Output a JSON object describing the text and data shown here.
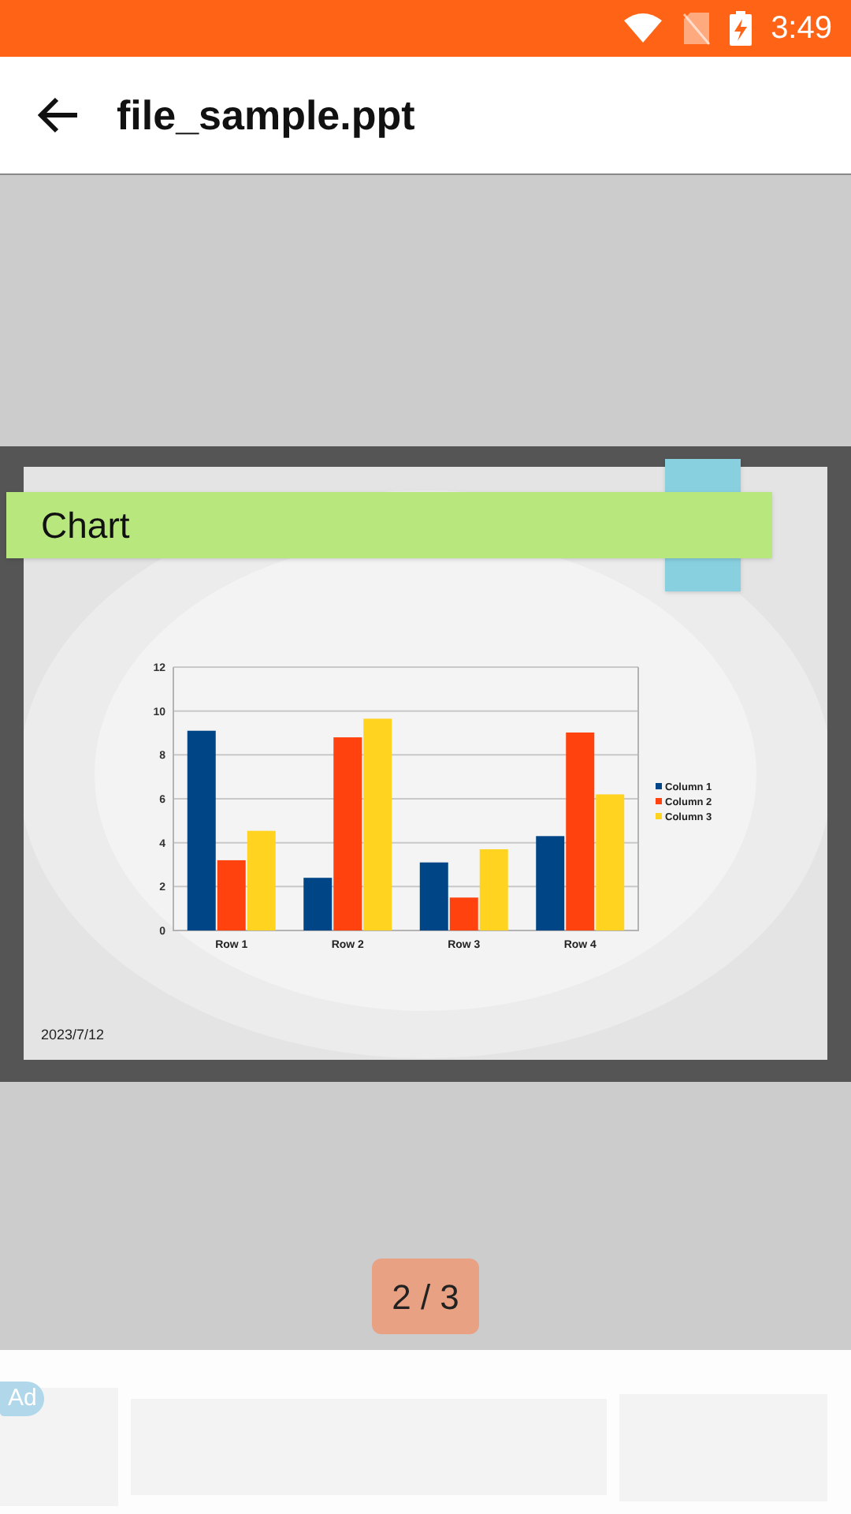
{
  "status_bar": {
    "time": "3:49"
  },
  "app_bar": {
    "title": "file_sample.ppt"
  },
  "slide": {
    "title": "Chart",
    "date": "2023/7/12",
    "chart_data": {
      "type": "bar",
      "categories": [
        "Row 1",
        "Row 2",
        "Row 3",
        "Row 4"
      ],
      "ylim": [
        0,
        12
      ],
      "yticks": [
        0,
        2,
        4,
        6,
        8,
        10,
        12
      ],
      "grid": true,
      "legend": true,
      "series": [
        {
          "name": "Column 1",
          "color": "#004586",
          "values": [
            9.1,
            2.4,
            3.1,
            4.3
          ]
        },
        {
          "name": "Column 2",
          "color": "#ff420e",
          "values": [
            3.2,
            8.8,
            1.5,
            9.02
          ]
        },
        {
          "name": "Column 3",
          "color": "#ffd320",
          "values": [
            4.54,
            9.65,
            3.7,
            6.2
          ]
        }
      ]
    }
  },
  "page_indicator": "2 / 3",
  "ad": {
    "badge": "Ad"
  }
}
